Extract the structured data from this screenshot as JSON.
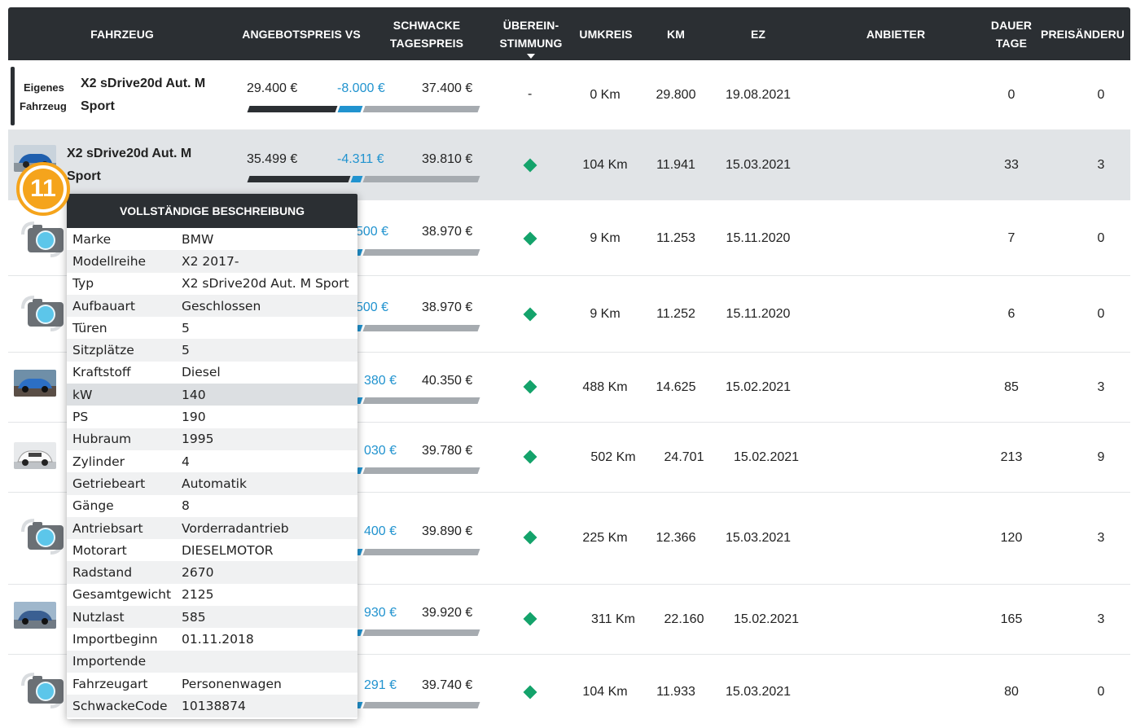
{
  "columns": {
    "fahrzeug": "FAHRZEUG",
    "angebotspreis": "ANGEBOTSPREIS VS",
    "schwacke_1": "SCHWACKE",
    "schwacke_2": "TAGESPREIS",
    "ueberein_1": "ÜBEREIN-",
    "ueberein_2": "STIMMUNG",
    "umkreis": "UMKREIS",
    "km": "KM",
    "ez": "EZ",
    "anbieter": "ANBIETER",
    "dauer_1": "DAUER",
    "dauer_2": "TAGE",
    "preisaenderung": "PREISÄNDERU"
  },
  "own_vehicle": {
    "label_1": "Eigenes",
    "label_2": "Fahrzeug",
    "model_1": "X2 sDrive20d Aut. M",
    "model_2": "Sport",
    "price": "29.400 €",
    "diff": "-8.000 €",
    "schwacke": "37.400 €",
    "match": "-",
    "umkreis": "0 Km",
    "km": "29.800",
    "ez": "19.08.2021",
    "dauer": "0",
    "preisaenderung": "0"
  },
  "rows": [
    {
      "model_1": "X2 sDrive20d Aut. M",
      "model_2": "Sport",
      "price": "35.499 €",
      "diff": "-4.311 €",
      "schwacke": "39.810 €",
      "umkreis": "104 Km",
      "km": "11.941",
      "ez": "15.03.2021",
      "dauer": "33",
      "preisaenderung": "3"
    },
    {
      "diff": "500 €",
      "schwacke": "38.970 €",
      "umkreis": "9 Km",
      "km": "11.253",
      "ez": "15.11.2020",
      "dauer": "7",
      "preisaenderung": "0"
    },
    {
      "diff": "500 €",
      "schwacke": "38.970 €",
      "umkreis": "9 Km",
      "km": "11.252",
      "ez": "15.11.2020",
      "dauer": "6",
      "preisaenderung": "0"
    },
    {
      "diff": "380 €",
      "schwacke": "40.350 €",
      "umkreis": "488 Km",
      "km": "14.625",
      "ez": "15.02.2021",
      "dauer": "85",
      "preisaenderung": "3"
    },
    {
      "diff": "030 €",
      "schwacke": "39.780 €",
      "umkreis": "502 Km",
      "km": "24.701",
      "ez": "15.02.2021",
      "dauer": "213",
      "preisaenderung": "9"
    },
    {
      "diff": "400 €",
      "schwacke": "39.890 €",
      "umkreis": "225 Km",
      "km": "12.366",
      "ez": "15.03.2021",
      "dauer": "120",
      "preisaenderung": "3"
    },
    {
      "diff": "930 €",
      "schwacke": "39.920 €",
      "umkreis": "311 Km",
      "km": "22.160",
      "ez": "15.02.2021",
      "dauer": "165",
      "preisaenderung": "3"
    },
    {
      "diff": "291 €",
      "schwacke": "39.740 €",
      "umkreis": "104 Km",
      "km": "11.933",
      "ez": "15.03.2021",
      "dauer": "80",
      "preisaenderung": "0"
    }
  ],
  "badge": "11",
  "popup": {
    "title": "VOLLSTÄNDIGE BESCHREIBUNG",
    "items": [
      {
        "k": "Marke",
        "v": "BMW"
      },
      {
        "k": "Modellreihe",
        "v": "X2 2017-"
      },
      {
        "k": "Typ",
        "v": "X2 sDrive20d Aut. M Sport"
      },
      {
        "k": "Aufbauart",
        "v": "Geschlossen"
      },
      {
        "k": "Türen",
        "v": "5"
      },
      {
        "k": "Sitzplätze",
        "v": "5"
      },
      {
        "k": "Kraftstoff",
        "v": "Diesel"
      },
      {
        "k": "kW",
        "v": "140"
      },
      {
        "k": "PS",
        "v": "190"
      },
      {
        "k": "Hubraum",
        "v": "1995"
      },
      {
        "k": "Zylinder",
        "v": "4"
      },
      {
        "k": "Getriebeart",
        "v": "Automatik"
      },
      {
        "k": "Gänge",
        "v": "8"
      },
      {
        "k": "Antriebsart",
        "v": "Vorderradantrieb"
      },
      {
        "k": "Motorart",
        "v": "DIESELMOTOR"
      },
      {
        "k": "Radstand",
        "v": "2670"
      },
      {
        "k": "Gesamtgewicht",
        "v": "2125"
      },
      {
        "k": "Nutzlast",
        "v": "585"
      },
      {
        "k": "Importbeginn",
        "v": "01.11.2018"
      },
      {
        "k": "Importende",
        "v": ""
      },
      {
        "k": "Fahrzeugart",
        "v": "Personenwagen"
      },
      {
        "k": "SchwackeCode",
        "v": "10138874"
      }
    ]
  },
  "colors": {
    "header": "#2b2f33",
    "accent_blue": "#2193cf",
    "match_green": "#14a36b",
    "badge_orange": "#f5a41c"
  }
}
